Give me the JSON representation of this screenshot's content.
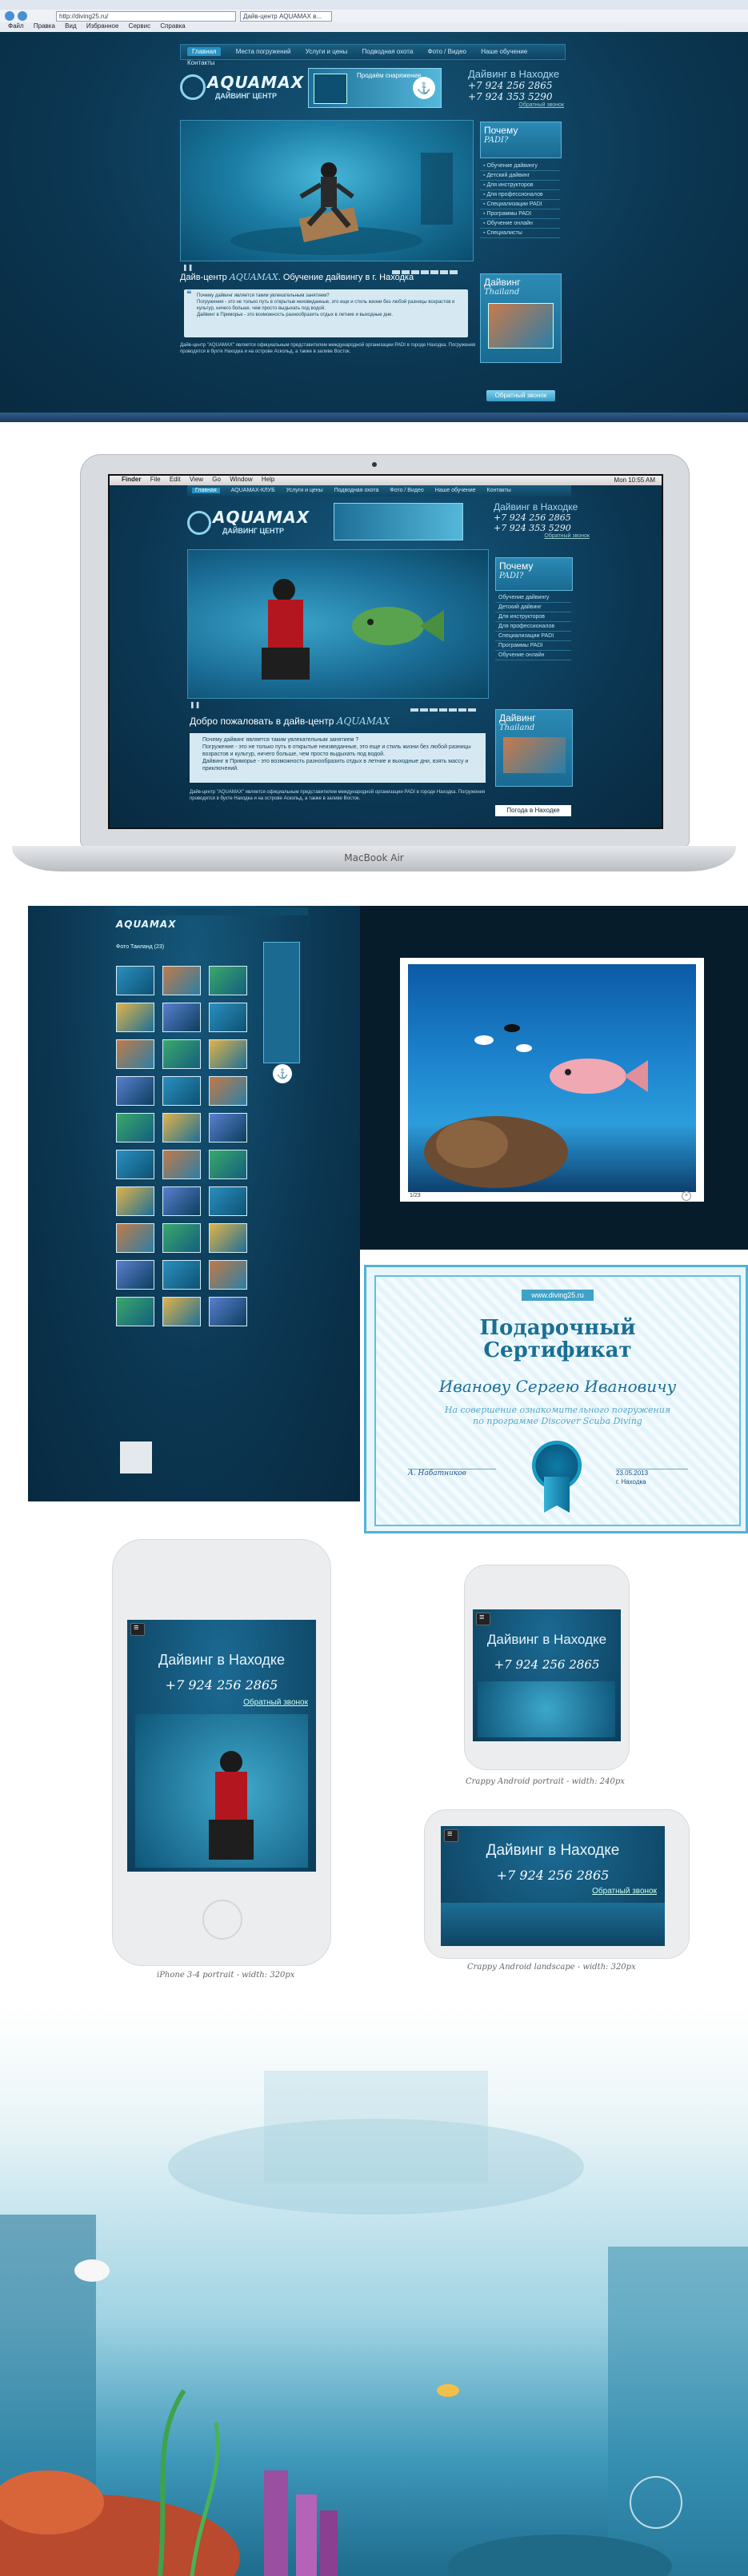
{
  "browser": {
    "url": "http://diving25.ru/",
    "tab_title": "Дайв-центр AQUAMAX в...",
    "menu": [
      "Файл",
      "Правка",
      "Вид",
      "Избранное",
      "Сервис",
      "Справка"
    ]
  },
  "site": {
    "nav": [
      "Главная",
      "Места погружений",
      "Услуги и цены",
      "Подводная охота",
      "Фото / Видео",
      "Наше обучение",
      "Контакты"
    ],
    "nav_active": "Главная",
    "logo_main": "AQUAMAX",
    "logo_sub": "ДАЙВИНГ ЦЕНТР",
    "promo": "Продаём снаряжение",
    "phones_heading": "Дайвинг в Находке",
    "phone1": "+7 924 256 2865",
    "phone2": "+7 924 353 5290",
    "callback": "Обратный звонок",
    "sidebar_why": "Почему",
    "sidebar_why_sub": "PADI?",
    "sidebar_links": [
      "Обучение дайвингу",
      "Детский дайвинг",
      "Для инструкторов",
      "Для профессионалов",
      "Специализации PADI",
      "Программы PADI",
      "Обучение онлайн",
      "Специалисты"
    ],
    "sidebar_diving": "Дайвинг",
    "sidebar_diving_sub": "Thailand",
    "main_title_prefix": "Дайв-центр",
    "main_title_brand": "AQUAMAX",
    "main_title_suffix": ". Обучение дайвингу в г. Находка",
    "quote_lines": [
      "Почему дайвинг является таким увлекательным занятием?",
      "Погружение - это не только путь в открытые неизведанные, это еще и стиль жизни без любой разницы возрастов и культур, ничего больше, чем просто выдыхать под водой.",
      "Дайвинг в Приморье - это возможность разнообразить отдых в летние и выходные дни."
    ],
    "paragraph": "Дайв-центр \"AQUAMAX\" является официальным представителем международной организации PADI в городе Находка. Погружения проводятся в бухте Находка и на острове Аскольд, а также в заливе Восток.",
    "callback_button": "Обратный звонок"
  },
  "mac": {
    "label": "MacBook Air",
    "menubar": [
      "Finder",
      "File",
      "Edit",
      "View",
      "Go",
      "Window",
      "Help"
    ],
    "clock": "Mon 10:55 AM",
    "nav": [
      "Главная",
      "AQUAMAX-КЛУБ",
      "Услуги и цены",
      "Подводная охота",
      "Фото / Видео",
      "Наше обучение",
      "Контакты"
    ],
    "logo_main": "AQUAMAX",
    "logo_sub": "ДАЙВИНГ ЦЕНТР",
    "phones_heading": "Дайвинг в Находке",
    "phone1": "+7 924 256 2865",
    "phone2": "+7 924 353 5290",
    "callback": "Обратный звонок",
    "sidebar_why": "Почему",
    "sidebar_why_sub": "PADI?",
    "sidebar_links": [
      "Обучение дайвингу",
      "Детский дайвинг",
      "Для инструкторов",
      "Для профессионалов",
      "Специализации PADI",
      "Программы PADI",
      "Обучение онлайн"
    ],
    "sidebar_diving": "Дайвинг",
    "sidebar_diving_sub": "Thailand",
    "welcome_prefix": "Добро пожаловать в дайв-центр",
    "welcome_brand": "AQUAMAX",
    "quote_lines": [
      "Почему дайвинг является таким увлекательным занятием ?",
      "Погружение - это не только путь в открытые неизведанные, это еще и стиль жизни без любой разницы возрастов и культур, ничего больше, чем просто выдыхать под водой.",
      "Дайвинг в Приморье - это возможность разнообразить отдых в летние и выходные дни, взять массу и приключений."
    ],
    "weather": "Погода в Находке"
  },
  "gallery": {
    "title": "Фото Таиланд (23)",
    "photo_caption": "1/23"
  },
  "certificate": {
    "url": "www.diving25.ru",
    "title_line1": "Подарочный",
    "title_line2": "Сертификат",
    "recipient": "Иванову Сергею Ивановичу",
    "line1": "На совершение ознакомительного погружения",
    "line2": "по программе Discover Scuba Diving",
    "signature": "А. Набатников",
    "date": "23.05.2013",
    "city": "г. Находка"
  },
  "phones": {
    "heading": "Дайвинг в Находке",
    "phone": "+7 924 256 2865",
    "callback": "Обратный звонок",
    "caption_iphone": "iPhone 3-4 portrait - width: 320px",
    "caption_android_portrait": "Crappy Android portrait - width: 240px",
    "caption_android_landscape": "Crappy Android landscape - width: 320px"
  }
}
